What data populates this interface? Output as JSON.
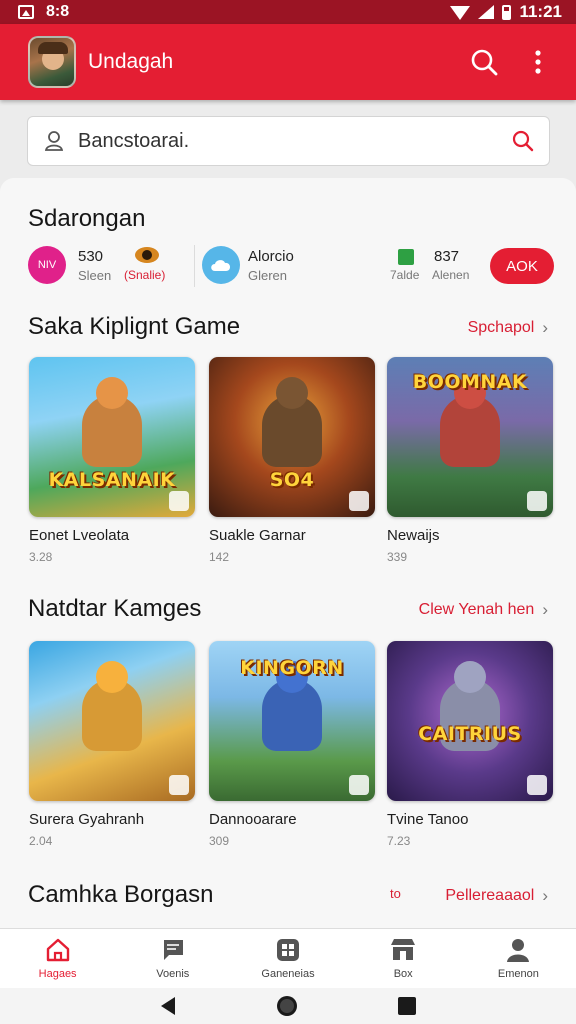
{
  "status_bar": {
    "time": "11:21",
    "left_text": "8:8"
  },
  "app_bar": {
    "title": "Undagah",
    "avatar_icon": "character-avatar",
    "search_icon": "search-icon",
    "more_icon": "more-vert-icon"
  },
  "search": {
    "placeholder": "Bancstoarai.",
    "leading_icon": "user-icon",
    "trailing_icon": "search-icon"
  },
  "profile_section": {
    "title": "Sdarongan",
    "stats": [
      {
        "badge": "NIV",
        "value": "530",
        "label": "Sleen",
        "badge_color": "#e0218a"
      },
      {
        "value": "",
        "label": "(Snalie)",
        "icon": "game-controller-icon"
      },
      {
        "value": "Alorcio",
        "label": "Gleren",
        "icon": "cloud-icon",
        "badge_color": "#56b6e8"
      },
      {
        "value": "",
        "label": "7alde",
        "icon": "green-square-icon",
        "badge_color": "#2ea043"
      },
      {
        "value": "837",
        "label": "Alenen"
      }
    ],
    "action_label": "AOK"
  },
  "section_1": {
    "title": "Saka Kiplignt Game",
    "link": "Spchapol",
    "games": [
      {
        "title": "Eonet Lveolata",
        "sub": "3.28",
        "art_text": "KALSANAIK"
      },
      {
        "title": "Suakle Garnar",
        "sub": "142",
        "art_text": "SO4"
      },
      {
        "title": "Newaijs",
        "sub": "339",
        "art_text": "BOOMNAK"
      }
    ]
  },
  "section_2": {
    "title": "Natdtar Kamges",
    "link": "Clew Yenah hen",
    "games": [
      {
        "title": "Surera Gyahranh",
        "sub": "2.04",
        "art_text": ""
      },
      {
        "title": "Dannooarare",
        "sub": "309",
        "art_text": "KINGORN"
      },
      {
        "title": "Tvine Tanoo",
        "sub": "7.23",
        "art_text": "CAITRIUS"
      }
    ]
  },
  "section_3": {
    "title": "Camhka Borgasn",
    "link": "Pellereaaaol",
    "extra": "to"
  },
  "bottom_nav": [
    {
      "label": "Hagaes",
      "icon": "home-icon",
      "active": true
    },
    {
      "label": "Voenis",
      "icon": "chat-icon",
      "active": false
    },
    {
      "label": "Ganeneias",
      "icon": "games-grid-icon",
      "active": false
    },
    {
      "label": "Box",
      "icon": "store-icon",
      "active": false
    },
    {
      "label": "Emenon",
      "icon": "profile-icon",
      "active": false
    }
  ],
  "colors": {
    "primary": "#e41e33",
    "status_bar": "#9b1424",
    "link": "#d81f34"
  }
}
